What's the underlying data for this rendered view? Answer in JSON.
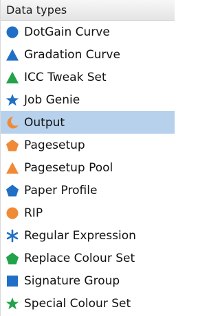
{
  "header": {
    "title": "Data types"
  },
  "selected_index": 4,
  "items": [
    {
      "label": "DotGain Curve",
      "icon": "circle",
      "color": "#1f6fc6"
    },
    {
      "label": "Gradation Curve",
      "icon": "triangle",
      "color": "#1f6fc6"
    },
    {
      "label": "ICC Tweak Set",
      "icon": "triangle",
      "color": "#22a24a"
    },
    {
      "label": "Job Genie",
      "icon": "star",
      "color": "#1f6fc6"
    },
    {
      "label": "Output",
      "icon": "crescent",
      "color": "#f08a36"
    },
    {
      "label": "Pagesetup",
      "icon": "pentagon",
      "color": "#f08a36"
    },
    {
      "label": "Pagesetup Pool",
      "icon": "triangle",
      "color": "#f08a36"
    },
    {
      "label": "Paper Profile",
      "icon": "pentagon",
      "color": "#1f6fc6"
    },
    {
      "label": "RIP",
      "icon": "circle",
      "color": "#f08a36"
    },
    {
      "label": "Regular Expression",
      "icon": "asterisk",
      "color": "#1f6fc6"
    },
    {
      "label": "Replace Colour Set",
      "icon": "pentagon",
      "color": "#22a24a"
    },
    {
      "label": "Signature Group",
      "icon": "square",
      "color": "#1f6fc6"
    },
    {
      "label": "Special Colour Set",
      "icon": "star",
      "color": "#22a24a"
    }
  ]
}
